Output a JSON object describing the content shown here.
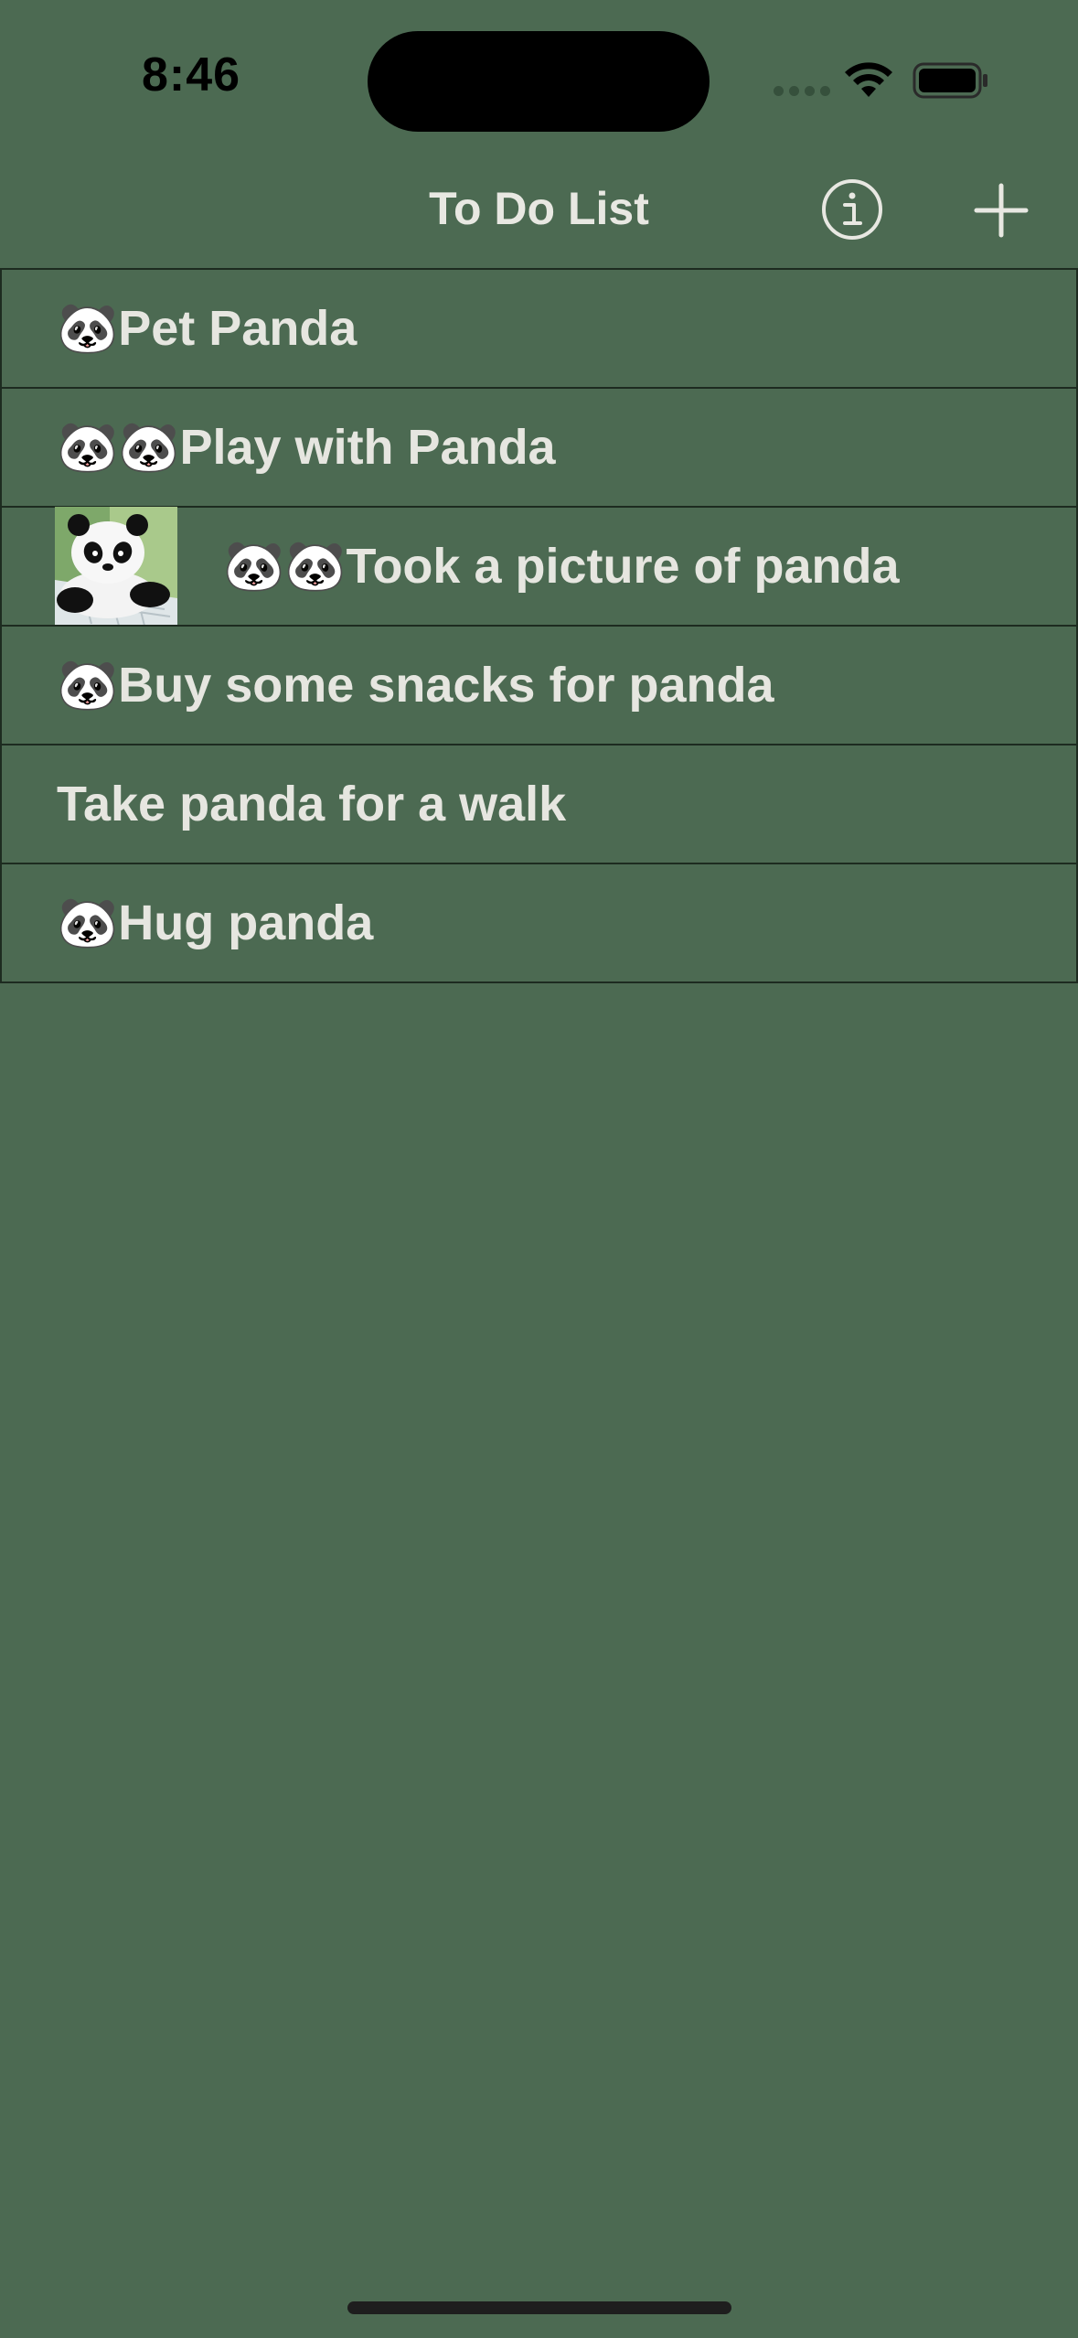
{
  "status_bar": {
    "time": "8:46"
  },
  "nav": {
    "title": "To Do List"
  },
  "todos": [
    {
      "text": "🐼Pet Panda",
      "has_image": false
    },
    {
      "text": "🐼🐼Play with Panda",
      "has_image": false
    },
    {
      "text": "🐼🐼Took a picture of panda",
      "has_image": true,
      "image": "panda-photo"
    },
    {
      "text": "🐼Buy some snacks for panda",
      "has_image": false
    },
    {
      "text": "Take panda for a walk",
      "has_image": false
    },
    {
      "text": "🐼Hug panda",
      "has_image": false
    }
  ],
  "colors": {
    "background": "#4c6a52",
    "text": "#e6e6e0",
    "separator": "#1d2b20"
  }
}
